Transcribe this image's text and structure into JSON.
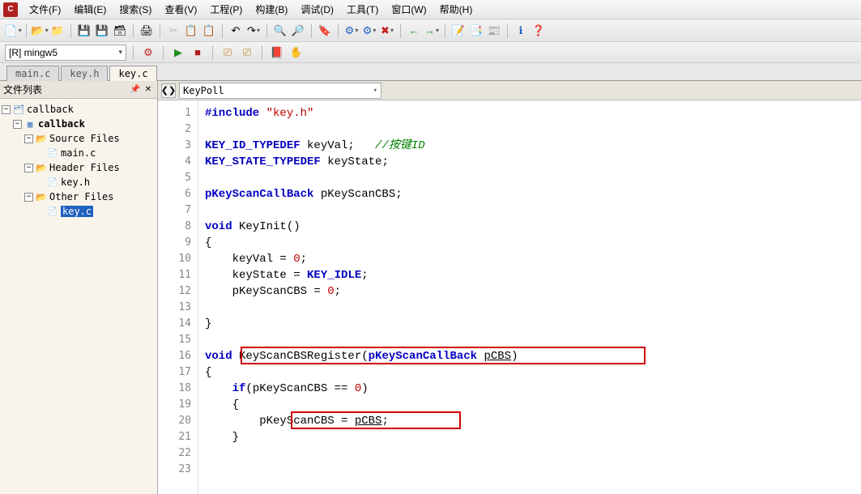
{
  "menu": {
    "file": "文件(F)",
    "edit": "编辑(E)",
    "search": "搜索(S)",
    "view": "查看(V)",
    "project": "工程(P)",
    "build": "构建(B)",
    "debug": "调试(D)",
    "tools": "工具(T)",
    "window": "窗口(W)",
    "help": "帮助(H)"
  },
  "config": {
    "target": "[R] mingw5"
  },
  "file_tabs": [
    "main.c",
    "key.h",
    "key.c"
  ],
  "active_tab": "key.c",
  "sidebar": {
    "title": "文件列表",
    "root": "callback",
    "project": "callback",
    "folders": [
      {
        "name": "Source Files",
        "files": [
          "main.c"
        ]
      },
      {
        "name": "Header Files",
        "files": [
          "key.h"
        ]
      },
      {
        "name": "Other Files",
        "files": [
          "key.c"
        ],
        "selected": "key.c"
      }
    ]
  },
  "funcbar": {
    "current": "KeyPoll"
  },
  "code": {
    "lines": [
      {
        "n": 1,
        "t": "#include \"key.h\"",
        "cls": "inc"
      },
      {
        "n": 2,
        "t": ""
      },
      {
        "n": 3,
        "t": "KEY_ID_TYPEDEF keyVal;   //按键ID",
        "cls": "decl1"
      },
      {
        "n": 4,
        "t": "KEY_STATE_TYPEDEF keyState;",
        "cls": "decl2"
      },
      {
        "n": 5,
        "t": ""
      },
      {
        "n": 6,
        "t": "pKeyScanCallBack pKeyScanCBS;",
        "cls": "decl3"
      },
      {
        "n": 7,
        "t": ""
      },
      {
        "n": 8,
        "t": "void KeyInit()",
        "cls": "fn1"
      },
      {
        "n": 9,
        "t": "{"
      },
      {
        "n": 10,
        "t": "    keyVal = 0;"
      },
      {
        "n": 11,
        "t": "    keyState = KEY_IDLE;"
      },
      {
        "n": 12,
        "t": "    pKeyScanCBS = 0;"
      },
      {
        "n": 13,
        "t": ""
      },
      {
        "n": 14,
        "t": "}"
      },
      {
        "n": 15,
        "t": ""
      },
      {
        "n": 16,
        "t": "void KeyScanCBSRegister(pKeyScanCallBack pCBS)",
        "cls": "fn2"
      },
      {
        "n": 17,
        "t": "{"
      },
      {
        "n": 18,
        "t": "    if(pKeyScanCBS == 0)"
      },
      {
        "n": 19,
        "t": "    {"
      },
      {
        "n": 20,
        "t": "        pKeyScanCBS = pCBS;"
      },
      {
        "n": 21,
        "t": "    }"
      },
      {
        "n": 22,
        "t": ""
      },
      {
        "n": 23,
        "t": ""
      }
    ]
  }
}
